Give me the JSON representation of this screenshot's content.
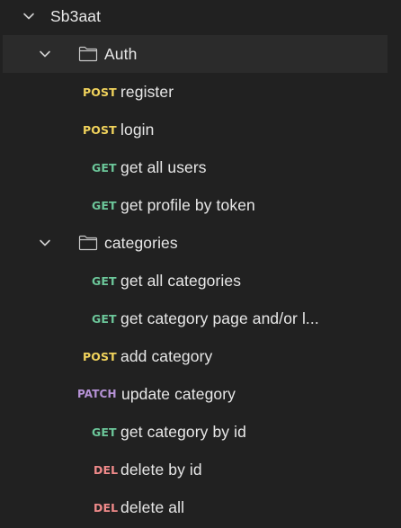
{
  "collection": {
    "name": "Sb3aat",
    "expanded": true
  },
  "folders": [
    {
      "name": "Auth",
      "expanded": true,
      "selected": true,
      "requests": [
        {
          "method": "POST",
          "name": "register"
        },
        {
          "method": "POST",
          "name": "login"
        },
        {
          "method": "GET",
          "name": "get all users"
        },
        {
          "method": "GET",
          "name": "get profile by token"
        }
      ]
    },
    {
      "name": "categories",
      "expanded": true,
      "selected": false,
      "requests": [
        {
          "method": "GET",
          "name": "get all categories"
        },
        {
          "method": "GET",
          "name": "get category page and/or l..."
        },
        {
          "method": "POST",
          "name": "add category"
        },
        {
          "method": "PATCH",
          "name": "update category"
        },
        {
          "method": "GET",
          "name": "get category by id"
        },
        {
          "method": "DEL",
          "name": "delete by id"
        },
        {
          "method": "DEL",
          "name": "delete all"
        }
      ]
    }
  ],
  "method_colors": {
    "POST": "#f1d35c",
    "GET": "#6cc79a",
    "DEL": "#f08a8a",
    "PATCH": "#b692d6"
  },
  "icons": {
    "expand": "chevron-down-icon",
    "folder": "folder-icon"
  }
}
